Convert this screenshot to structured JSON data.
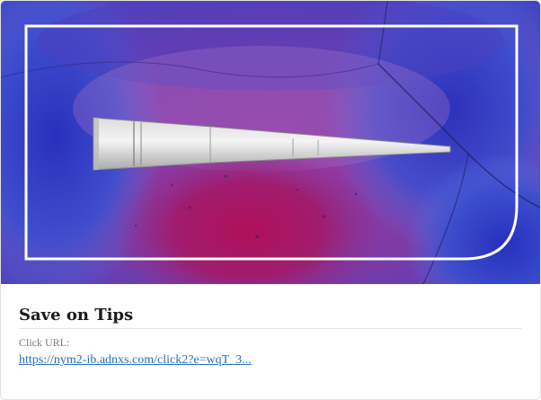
{
  "ad": {
    "title": "Save on Tips",
    "click_url_label": "Click URL:",
    "click_url": "https://nym2-ib.adnxs.com/click2?e=wqT_3..."
  },
  "colors": {
    "link": "#2a6fb5",
    "frame": "#ffffff",
    "magenta": "#8a2f8f",
    "violet": "#6a3fb8",
    "blue": "#2f3fbf"
  },
  "hero": {
    "image_subject": "pipette-tip-on-stained-microscopy-background",
    "frame_icon": "rounded-corner-frame-icon"
  }
}
